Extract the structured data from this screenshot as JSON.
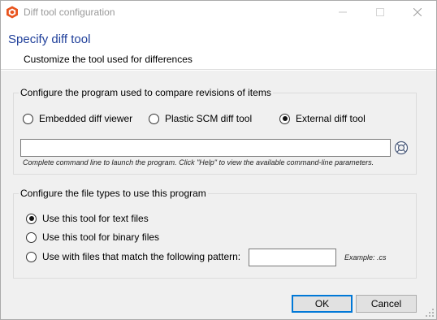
{
  "window": {
    "title": "Diff tool configuration",
    "accent_color": "#1f3f9a",
    "app_icon": "plastic-scm-logo"
  },
  "header": {
    "title": "Specify diff tool",
    "subtitle": "Customize the tool used for differences"
  },
  "program_group": {
    "title": "Configure the program used to compare revisions of items",
    "options": [
      {
        "label": "Embedded diff viewer",
        "checked": false
      },
      {
        "label": "Plastic SCM diff tool",
        "checked": false
      },
      {
        "label": "External diff tool",
        "checked": true
      }
    ],
    "command_line": {
      "value": "",
      "placeholder": ""
    },
    "hint": "Complete command line to launch the program. Click \"Help\" to view the available command-line parameters.",
    "help_icon": "help-lifebuoy-icon"
  },
  "filetype_group": {
    "title": "Configure the file types to use this program",
    "options": [
      {
        "label": "Use this tool for text files",
        "checked": true
      },
      {
        "label": "Use this tool for binary files",
        "checked": false
      },
      {
        "label": "Use with files that match the following pattern:",
        "checked": false
      }
    ],
    "pattern": {
      "value": "",
      "placeholder": ""
    },
    "example": "Example: .cs"
  },
  "footer": {
    "ok_label": "OK",
    "cancel_label": "Cancel"
  }
}
